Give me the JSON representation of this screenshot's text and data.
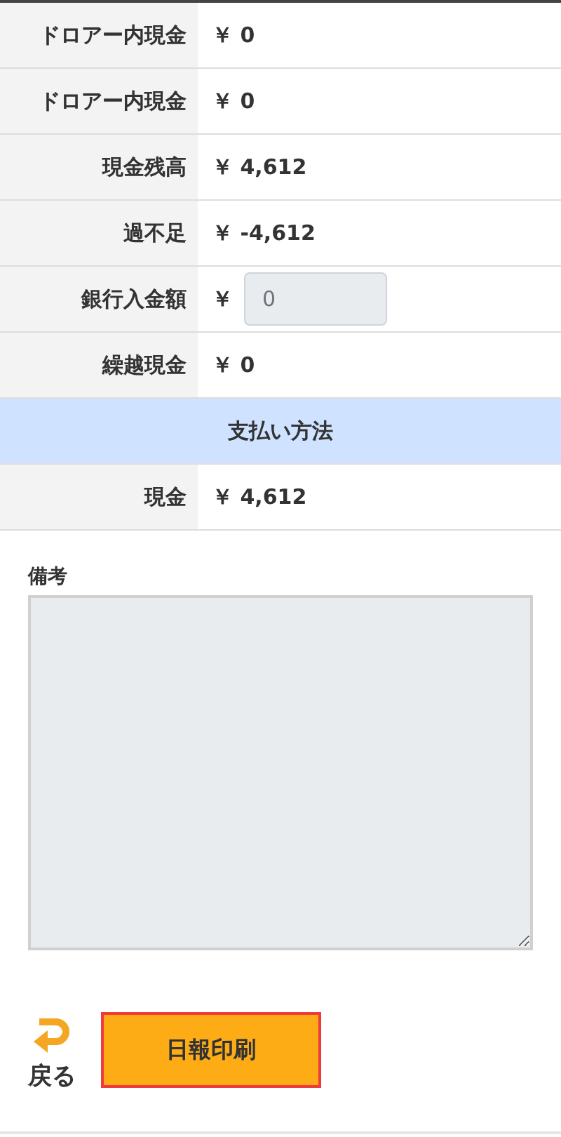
{
  "summary_rows": [
    {
      "kind": "amount",
      "label": "ドロアー内現金",
      "currency": "￥",
      "value": "0"
    },
    {
      "kind": "amount",
      "label": "ドロアー内現金",
      "currency": "￥",
      "value": "0"
    },
    {
      "kind": "amount",
      "label": "現金残高",
      "currency": "￥",
      "value": "4,612"
    },
    {
      "kind": "amount",
      "label": "過不足",
      "currency": "￥",
      "value": "-4,612"
    },
    {
      "kind": "input",
      "label": "銀行入金額",
      "currency": "￥",
      "value": "0"
    },
    {
      "kind": "amount",
      "label": "繰越現金",
      "currency": "￥",
      "value": "0"
    }
  ],
  "payment_section": {
    "title": "支払い方法",
    "rows": [
      {
        "kind": "amount",
        "label": "現金",
        "currency": "￥",
        "value": "4,612"
      }
    ]
  },
  "notes": {
    "label": "備考"
  },
  "back_button": {
    "label": "戻る"
  },
  "print_button": {
    "label": "日報印刷"
  }
}
